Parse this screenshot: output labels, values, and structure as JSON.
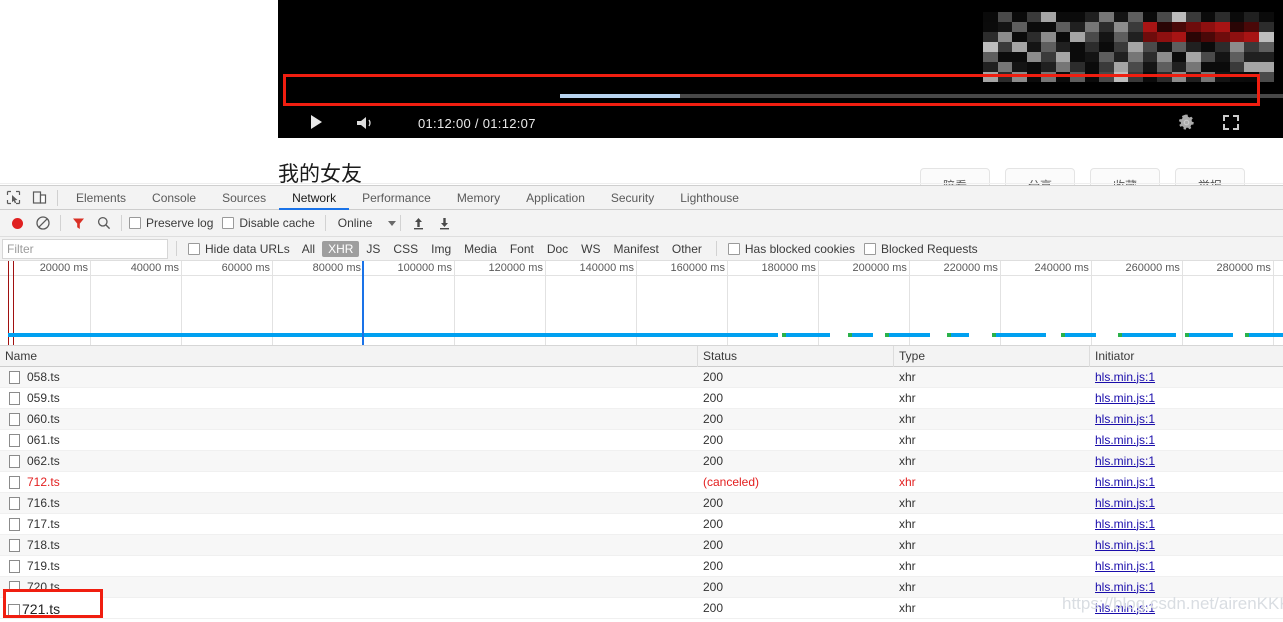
{
  "video": {
    "time_current": "01:12:00",
    "time_total": "01:12:07",
    "time_display": "01:12:00 / 01:12:07",
    "play_icon": "play-icon",
    "volume_icon": "volume-icon",
    "settings_icon": "gear-icon",
    "fullscreen_icon": "fullscreen-icon",
    "progress_percent": 99,
    "buffered_percent": 12,
    "highlight_color": "#f01e10"
  },
  "page": {
    "title": "我的女友",
    "action_buttons": [
      {
        "label": "陪看"
      },
      {
        "label": "分享"
      },
      {
        "label": "收藏"
      },
      {
        "label": "举报"
      }
    ]
  },
  "devtools": {
    "left_icons": [
      {
        "name": "inspect-element-icon"
      },
      {
        "name": "device-toolbar-icon"
      }
    ],
    "tabs": [
      {
        "label": "Elements",
        "active": false
      },
      {
        "label": "Console",
        "active": false
      },
      {
        "label": "Sources",
        "active": false
      },
      {
        "label": "Network",
        "active": true
      },
      {
        "label": "Performance",
        "active": false
      },
      {
        "label": "Memory",
        "active": false
      },
      {
        "label": "Application",
        "active": false
      },
      {
        "label": "Security",
        "active": false
      },
      {
        "label": "Lighthouse",
        "active": false
      }
    ],
    "active_tab_underline_color": "#1a73e8",
    "controlbar": {
      "record_icon": "record-icon",
      "record_color": "#e02020",
      "clear_icon": "clear-icon",
      "filter_icon": "filter-funnel-icon",
      "filter_icon_color": "#d93025",
      "search_icon": "search-icon",
      "preserve_log_label": "Preserve log",
      "preserve_log_checked": false,
      "disable_cache_label": "Disable cache",
      "disable_cache_checked": false,
      "throttle_value": "Online",
      "import_har_icon": "upload-icon",
      "export_har_icon": "download-icon"
    },
    "filterbar": {
      "filter_placeholder": "Filter",
      "filter_value": "",
      "hide_data_urls_label": "Hide data URLs",
      "hide_data_urls_checked": false,
      "resource_types": [
        {
          "label": "All",
          "active": false
        },
        {
          "label": "XHR",
          "active": true
        },
        {
          "label": "JS",
          "active": false
        },
        {
          "label": "CSS",
          "active": false
        },
        {
          "label": "Img",
          "active": false
        },
        {
          "label": "Media",
          "active": false
        },
        {
          "label": "Font",
          "active": false
        },
        {
          "label": "Doc",
          "active": false
        },
        {
          "label": "WS",
          "active": false
        },
        {
          "label": "Manifest",
          "active": false
        },
        {
          "label": "Other",
          "active": false
        }
      ],
      "has_blocked_cookies_label": "Has blocked cookies",
      "has_blocked_cookies_checked": false,
      "blocked_requests_label": "Blocked Requests",
      "blocked_requests_checked": false
    },
    "overview": {
      "tick_labels": [
        "20000 ms",
        "40000 ms",
        "60000 ms",
        "80000 ms",
        "100000 ms",
        "120000 ms",
        "140000 ms",
        "160000 ms",
        "180000 ms",
        "200000 ms",
        "220000 ms",
        "240000 ms",
        "260000 ms",
        "280000 ms"
      ],
      "tick_interval_ms": 20000,
      "cursor_label": "80000 ms",
      "request_band_color": "#00a0f0",
      "event_marker_color": "#a01010"
    },
    "table": {
      "columns": [
        "Name",
        "Status",
        "Type",
        "Initiator"
      ],
      "rows": [
        {
          "name": "058.ts",
          "status": "200",
          "type": "xhr",
          "initiator": "hls.min.js:1",
          "error": false
        },
        {
          "name": "059.ts",
          "status": "200",
          "type": "xhr",
          "initiator": "hls.min.js:1",
          "error": false
        },
        {
          "name": "060.ts",
          "status": "200",
          "type": "xhr",
          "initiator": "hls.min.js:1",
          "error": false
        },
        {
          "name": "061.ts",
          "status": "200",
          "type": "xhr",
          "initiator": "hls.min.js:1",
          "error": false
        },
        {
          "name": "062.ts",
          "status": "200",
          "type": "xhr",
          "initiator": "hls.min.js:1",
          "error": false
        },
        {
          "name": "712.ts",
          "status": "(canceled)",
          "type": "xhr",
          "initiator": "hls.min.js:1",
          "error": true
        },
        {
          "name": "716.ts",
          "status": "200",
          "type": "xhr",
          "initiator": "hls.min.js:1",
          "error": false
        },
        {
          "name": "717.ts",
          "status": "200",
          "type": "xhr",
          "initiator": "hls.min.js:1",
          "error": false
        },
        {
          "name": "718.ts",
          "status": "200",
          "type": "xhr",
          "initiator": "hls.min.js:1",
          "error": false
        },
        {
          "name": "719.ts",
          "status": "200",
          "type": "xhr",
          "initiator": "hls.min.js:1",
          "error": false
        },
        {
          "name": "720.ts",
          "status": "200",
          "type": "xhr",
          "initiator": "hls.min.js:1",
          "error": false
        },
        {
          "name": "721.ts",
          "status": "200",
          "type": "xhr",
          "initiator": "hls.min.js:1",
          "error": false
        }
      ]
    }
  },
  "annotations": {
    "highlighted_row_name": "721.ts",
    "box_color": "#f01e10"
  },
  "watermark": {
    "text": "https://blog.csdn.net/airenKKK"
  }
}
